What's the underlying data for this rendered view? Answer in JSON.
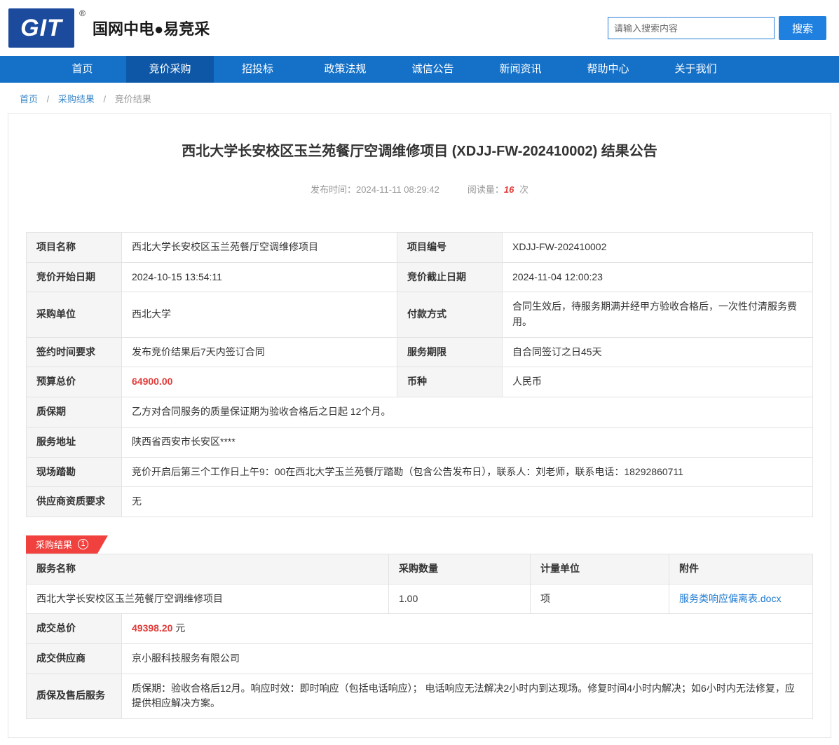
{
  "colors": {
    "nav_blue": "#1571c8",
    "nav_active_blue": "#0d57a6",
    "logo_blue": "#1c4b9e",
    "accent_red": "#e23c39",
    "ribbon_red": "#f0413e",
    "link_blue": "#1e7ad2"
  },
  "header": {
    "logo_text": "GIT",
    "logo_reg": "®",
    "brand": "国网中电●易竞采",
    "search_placeholder": "请输入搜索内容",
    "search_button": "搜索"
  },
  "nav": {
    "items": [
      "首页",
      "竞价采购",
      "招投标",
      "政策法规",
      "诚信公告",
      "新闻资讯",
      "帮助中心",
      "关于我们"
    ]
  },
  "breadcrumb": {
    "separator": "/",
    "items": [
      "首页",
      "采购结果",
      "竞价结果"
    ]
  },
  "article": {
    "title": "西北大学长安校区玉兰苑餐厅空调维修项目 (XDJJ-FW-202410002) 结果公告",
    "publish_label": "发布时间：",
    "publish_time": "2024-11-11 08:29:42",
    "views_label": "阅读量：",
    "views": "16",
    "views_unit": "次"
  },
  "details": {
    "rows": [
      [
        "项目名称",
        "西北大学长安校区玉兰苑餐厅空调维修项目",
        "项目编号",
        "XDJJ-FW-202410002"
      ],
      [
        "竞价开始日期",
        "2024-10-15 13:54:11",
        "竞价截止日期",
        "2024-11-04 12:00:23"
      ],
      [
        "采购单位",
        "西北大学",
        "付款方式",
        "合同生效后，待服务期满并经甲方验收合格后，一次性付清服务费用。"
      ],
      [
        "签约时间要求",
        "发布竞价结果后7天内签订合同",
        "服务期限",
        "自合同签订之日45天"
      ],
      [
        "预算总价",
        "64900.00",
        "币种",
        "人民币"
      ],
      [
        "质保期",
        "乙方对合同服务的质量保证期为验收合格后之日起 12个月。"
      ],
      [
        "服务地址",
        "陕西省西安市长安区****"
      ],
      [
        "现场踏勘",
        "竞价开启后第三个工作日上午9：00在西北大学玉兰苑餐厅踏勘（包含公告发布日），联系人：刘老师，联系电话：18292860711"
      ],
      [
        "供应商资质要求",
        "无"
      ]
    ]
  },
  "result": {
    "tag": "采购结果",
    "tag_number": "1",
    "headers": [
      "服务名称",
      "采购数量",
      "计量单位",
      "附件"
    ],
    "row": {
      "service": "西北大学长安校区玉兰苑餐厅空调维修项目",
      "quantity": "1.00",
      "unit": "项",
      "attachment": "服务类响应偏离表.docx"
    },
    "total_label": "成交总价",
    "total_value": "49398.20",
    "total_unit": "元",
    "supplier_label": "成交供应商",
    "supplier": "京小服科技服务有限公司",
    "warranty_label": "质保及售后服务",
    "warranty": "质保期：验收合格后12月。响应时效：即时响应（包括电话响应）； 电话响应无法解决2小时内到达现场。修复时间4小时内解决；如6小时内无法修复，应提供相应解决方案。"
  }
}
